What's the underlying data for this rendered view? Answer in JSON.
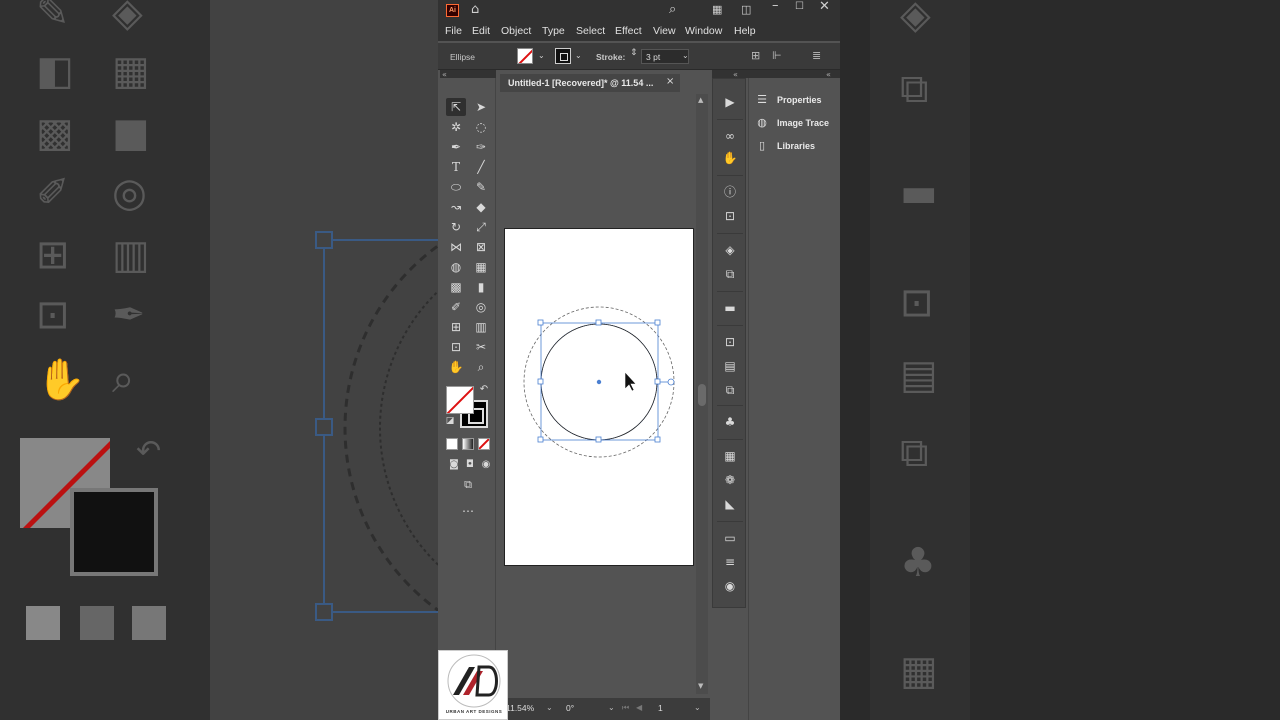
{
  "app": {
    "logo": "Ai",
    "menus": [
      "File",
      "Edit",
      "Object",
      "Type",
      "Select",
      "Effect",
      "View",
      "Window",
      "Help"
    ]
  },
  "control_bar": {
    "object_type": "Ellipse",
    "stroke_label": "Stroke:",
    "stroke_weight": "3 pt"
  },
  "document": {
    "tab_title": "Untitled-1 [Recovered]* @ 11.54 ...",
    "close_glyph": "×"
  },
  "status_bar": {
    "zoom": "11.54%",
    "rotation": "0°",
    "artboard_number": "1"
  },
  "panels": [
    {
      "label": "Properties",
      "icon": "sliders-icon"
    },
    {
      "label": "Image Trace",
      "icon": "image-trace-icon"
    },
    {
      "label": "Libraries",
      "icon": "libraries-icon"
    }
  ],
  "colors": {
    "accent_selection": "#4a7fd1",
    "fill_none_slash": "#dd1111",
    "app_bg": "#535353",
    "menubar_bg": "#323232"
  },
  "watermark": {
    "text": "URBAN ART DESIGNS"
  }
}
